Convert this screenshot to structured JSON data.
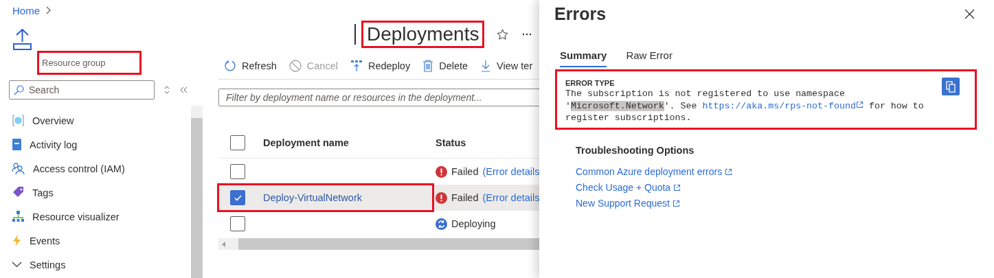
{
  "breadcrumb": [
    {
      "label": "Home"
    }
  ],
  "resource": {
    "subtitle": "Resource group",
    "highlighted": true
  },
  "sidebar": {
    "search": {
      "placeholder": "Search"
    },
    "items": [
      {
        "label": "Overview",
        "kind": "link"
      },
      {
        "label": "Activity log",
        "kind": "link"
      },
      {
        "label": "Access control (IAM)",
        "kind": "link"
      },
      {
        "label": "Tags",
        "kind": "link"
      },
      {
        "label": "Resource visualizer",
        "kind": "link"
      },
      {
        "label": "Events",
        "kind": "link"
      },
      {
        "label": "Settings",
        "kind": "group",
        "expanded": true
      }
    ]
  },
  "page": {
    "title": "Deployments",
    "highlighted": true
  },
  "toolbar": [
    {
      "label": "Refresh",
      "disabled": false
    },
    {
      "label": "Cancel",
      "disabled": true
    },
    {
      "label": "Redeploy",
      "disabled": false
    },
    {
      "label": "Delete",
      "disabled": false
    },
    {
      "label": "View ter",
      "disabled": false
    }
  ],
  "filter": {
    "placeholder": "Filter by deployment name or resources in the deployment..."
  },
  "table": {
    "all_checked": false,
    "columns": [
      "Deployment name",
      "Status"
    ],
    "rows": [
      {
        "name": "",
        "checked": false,
        "selected": false,
        "highlighted": false,
        "kind": "failed",
        "status": "Failed",
        "link": "(Error details"
      },
      {
        "name": "Deploy-VirtualNetwork",
        "checked": true,
        "selected": true,
        "highlighted": true,
        "kind": "failed",
        "status": "Failed",
        "link": "(Error details"
      },
      {
        "name": "",
        "checked": false,
        "selected": false,
        "highlighted": false,
        "kind": "deploying",
        "status": "Deploying",
        "link": ""
      }
    ]
  },
  "panel": {
    "title": "Errors",
    "tabs": [
      {
        "label": "Summary",
        "selected": true
      },
      {
        "label": "Raw Error",
        "selected": false
      }
    ],
    "error": {
      "highlighted": true,
      "label": "ERROR TYPE",
      "segments": [
        {
          "kind": "text",
          "text": "The subscription is not registered to use namespace '"
        },
        {
          "kind": "highlight",
          "text": "Microsoft.Network"
        },
        {
          "kind": "text",
          "text": "'. See "
        },
        {
          "kind": "link",
          "text": "https://aka.ms/rps-not-found"
        },
        {
          "kind": "text",
          "text": " for how to register subscriptions."
        }
      ]
    },
    "troubleshooting": {
      "heading": "Troubleshooting Options",
      "links": [
        "Common Azure deployment errors",
        "Check Usage + Quota",
        "New Support Request"
      ]
    }
  }
}
